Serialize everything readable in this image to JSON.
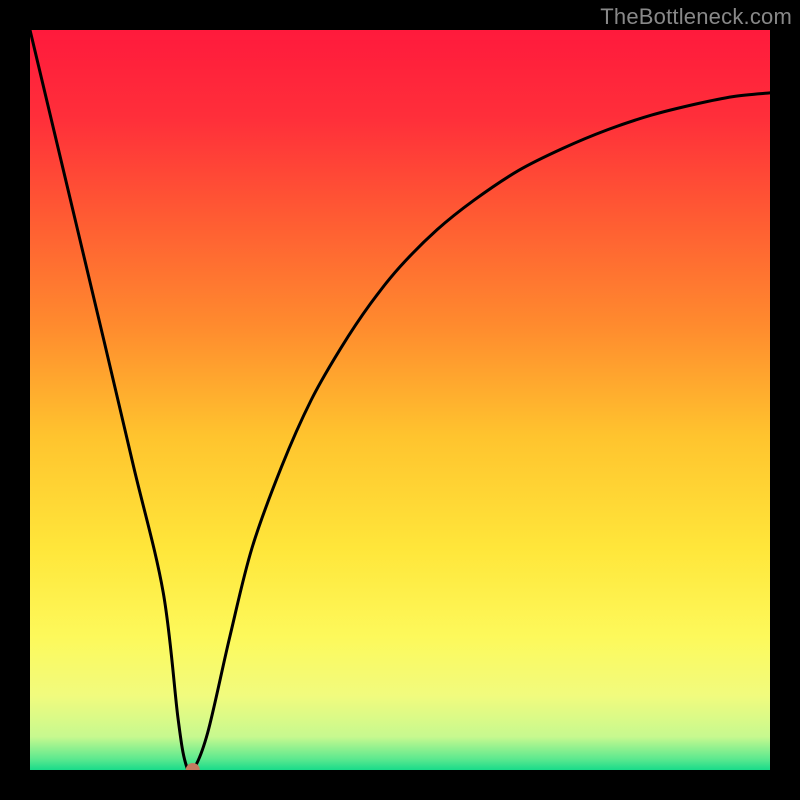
{
  "watermark": "TheBottleneck.com",
  "chart_data": {
    "type": "line",
    "title": "",
    "xlabel": "",
    "ylabel": "",
    "xlim": [
      0,
      100
    ],
    "ylim": [
      0,
      100
    ],
    "grid": false,
    "axes_visible": false,
    "background": {
      "type": "vertical-gradient",
      "stops": [
        {
          "t": 0.0,
          "color": "#ff1a3c"
        },
        {
          "t": 0.12,
          "color": "#ff2f3a"
        },
        {
          "t": 0.25,
          "color": "#ff5a33"
        },
        {
          "t": 0.4,
          "color": "#ff8b2e"
        },
        {
          "t": 0.55,
          "color": "#ffc42e"
        },
        {
          "t": 0.7,
          "color": "#ffe63a"
        },
        {
          "t": 0.82,
          "color": "#fdf95b"
        },
        {
          "t": 0.9,
          "color": "#f1fb7e"
        },
        {
          "t": 0.955,
          "color": "#c7f98f"
        },
        {
          "t": 0.985,
          "color": "#5de98f"
        },
        {
          "t": 1.0,
          "color": "#19db8a"
        }
      ]
    },
    "series": [
      {
        "name": "bottleneck-curve",
        "color": "#000000",
        "stroke_width": 3,
        "x": [
          0,
          5,
          10,
          14,
          18,
          20,
          21,
          22,
          24,
          27,
          30,
          34,
          38,
          42,
          46,
          50,
          55,
          60,
          66,
          72,
          78,
          84,
          90,
          95,
          100
        ],
        "y": [
          100,
          79,
          58,
          41,
          24,
          7,
          1,
          0,
          5,
          18,
          30,
          41,
          50,
          57,
          63,
          68,
          73,
          77,
          81,
          84,
          86.5,
          88.5,
          90,
          91,
          91.5
        ]
      }
    ],
    "marker": {
      "name": "optimal-point",
      "x": 22,
      "y": 0,
      "r": 7,
      "color": "#c47b60"
    }
  }
}
